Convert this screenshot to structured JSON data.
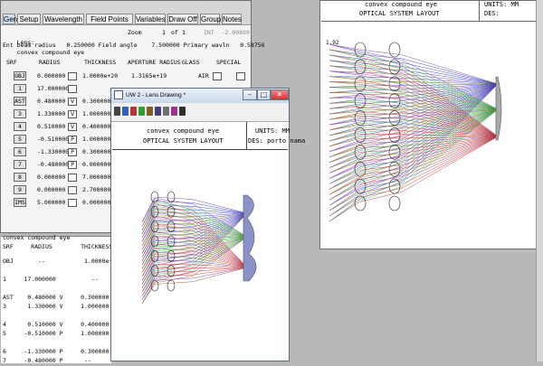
{
  "toolbar": {
    "buttons": [
      "Gen",
      "Setup",
      "Wavelength",
      "Field Points",
      "Variables",
      "Draw Off",
      "Group",
      "Notes"
    ],
    "active": "Gen"
  },
  "editor": {
    "lens_label": "Lens:",
    "lens_name": "convex compound eye",
    "zoom_label": "Zoom",
    "zoom_value": "1",
    "zoom_of": "of",
    "zoom_total": "1",
    "extra": "INT  -2.09899",
    "line2": "Ent beam radius   0.250000 Field angle    7.500000 Primary wavln   0.58756",
    "headers": [
      "SRF",
      "RADIUS",
      "THICKNESS",
      "APERTURE RADIUS",
      "GLASS",
      "SPECIAL"
    ],
    "rows": [
      {
        "srf": "OBJ",
        "radius": "0.000000",
        "thick": "1.0000e+20",
        "ap": "1.3165e+19",
        "glass": "AIR"
      },
      {
        "srf": "1",
        "radius": "17.000000",
        "thick": "",
        "ap": "",
        "glass": ""
      },
      {
        "srf": "AST",
        "radius": "0.480000",
        "thick": "0.300000",
        "ap": "",
        "glass": ""
      },
      {
        "srf": "3",
        "radius": "1.330000",
        "thick": "1.000000",
        "ap": "",
        "glass": ""
      },
      {
        "srf": "4",
        "radius": "0.510000",
        "thick": "0.400000",
        "ap": "",
        "glass": ""
      },
      {
        "srf": "5",
        "radius": "-0.510000",
        "thick": "1.000000",
        "ap": "",
        "glass": ""
      },
      {
        "srf": "6",
        "radius": "-1.330000",
        "thick": "0.300000",
        "ap": "",
        "glass": ""
      },
      {
        "srf": "7",
        "radius": "-0.480000",
        "thick": "0.000000",
        "ap": "",
        "glass": ""
      },
      {
        "srf": "8",
        "radius": "0.000000",
        "thick": "7.000000",
        "ap": "",
        "glass": ""
      },
      {
        "srf": "9",
        "radius": "0.000000",
        "thick": "2.700000",
        "ap": "",
        "glass": ""
      },
      {
        "srf": "IMS",
        "radius": "5.000000",
        "thick": "0.000000",
        "ap": "",
        "glass": ""
      }
    ],
    "row_flags": [
      "",
      "",
      "V",
      "V",
      "V",
      "P",
      "P",
      "P",
      "",
      "",
      ""
    ]
  },
  "listing": {
    "title": "convex compound eye",
    "header": "SRF     RADIUS        THICKNESS",
    "lines": [
      "OBJ       --           1.0000e+20",
      "",
      "1     17.000000          --",
      "",
      "AST    0.480000 V     0.300000",
      "3      1.330000 V     1.000000",
      "",
      "4      0.510000 V     0.400000",
      "5     -0.510000 P     1.000000",
      "",
      "6     -1.330000 P     0.300000",
      "7     -0.480000 P      --"
    ]
  },
  "lens_window": {
    "title": "UW 2 - Lens Drawing *",
    "header_title": "convex compound eye",
    "header_subtitle": "OPTICAL SYSTEM LAYOUT",
    "units": "UNITS: MM",
    "designer": "DES: porto nama"
  },
  "right_drawing": {
    "header_title": "convex compound eye",
    "header_subtitle": "OPTICAL SYSTEM LAYOUT",
    "units": "UNITS: MM",
    "designer": "DES:",
    "scale_label": "1.92"
  },
  "colors": {
    "ray_blue": "#2f3fd0",
    "ray_green": "#2fb52f",
    "ray_red": "#d02f2f",
    "ray_purple": "#7b3fa6",
    "ray_brown": "#8a5a2a",
    "desktop": "#b8b8b8"
  }
}
